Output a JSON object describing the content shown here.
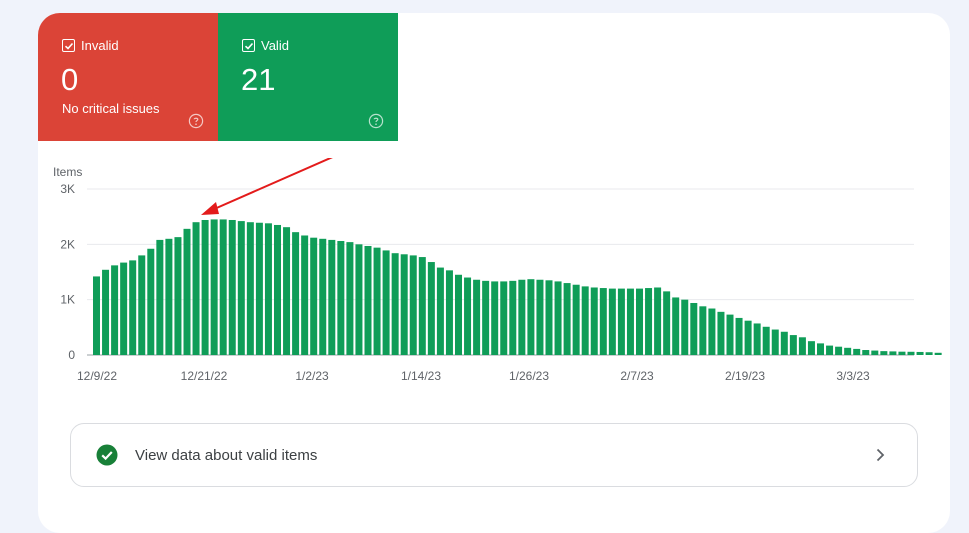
{
  "tiles": {
    "invalid": {
      "label": "Invalid",
      "count": "0",
      "subtitle": "No critical issues",
      "color": "#db4437"
    },
    "valid": {
      "label": "Valid",
      "count": "21",
      "color": "#0f9d58"
    }
  },
  "chart_data": {
    "type": "bar",
    "title": "",
    "ylabel": "Items",
    "ylim": [
      0,
      3000
    ],
    "yticks": [
      "0",
      "1K",
      "2K",
      "3K"
    ],
    "ytick_values": [
      0,
      1000,
      2000,
      3000
    ],
    "xtick_labels": [
      "12/9/22",
      "12/21/22",
      "1/2/23",
      "1/14/23",
      "1/26/23",
      "2/7/23",
      "2/19/23",
      "3/3/23"
    ],
    "series_color": "#0f9d58",
    "grid": true,
    "values": [
      1420,
      1540,
      1620,
      1670,
      1710,
      1800,
      1920,
      2080,
      2100,
      2130,
      2280,
      2400,
      2440,
      2450,
      2450,
      2440,
      2420,
      2400,
      2390,
      2380,
      2350,
      2310,
      2220,
      2160,
      2120,
      2100,
      2080,
      2060,
      2040,
      2000,
      1970,
      1940,
      1890,
      1840,
      1820,
      1800,
      1770,
      1680,
      1580,
      1530,
      1450,
      1400,
      1360,
      1340,
      1330,
      1330,
      1340,
      1360,
      1370,
      1360,
      1350,
      1330,
      1300,
      1270,
      1240,
      1220,
      1210,
      1200,
      1200,
      1200,
      1200,
      1210,
      1220,
      1150,
      1040,
      1000,
      940,
      880,
      840,
      780,
      730,
      670,
      620,
      570,
      510,
      460,
      420,
      360,
      320,
      250,
      210,
      170,
      150,
      130,
      110,
      90,
      80,
      70,
      65,
      60,
      58,
      55,
      50,
      40
    ]
  },
  "view_link": {
    "label": "View data about valid items",
    "accent": "#0f7a44"
  }
}
